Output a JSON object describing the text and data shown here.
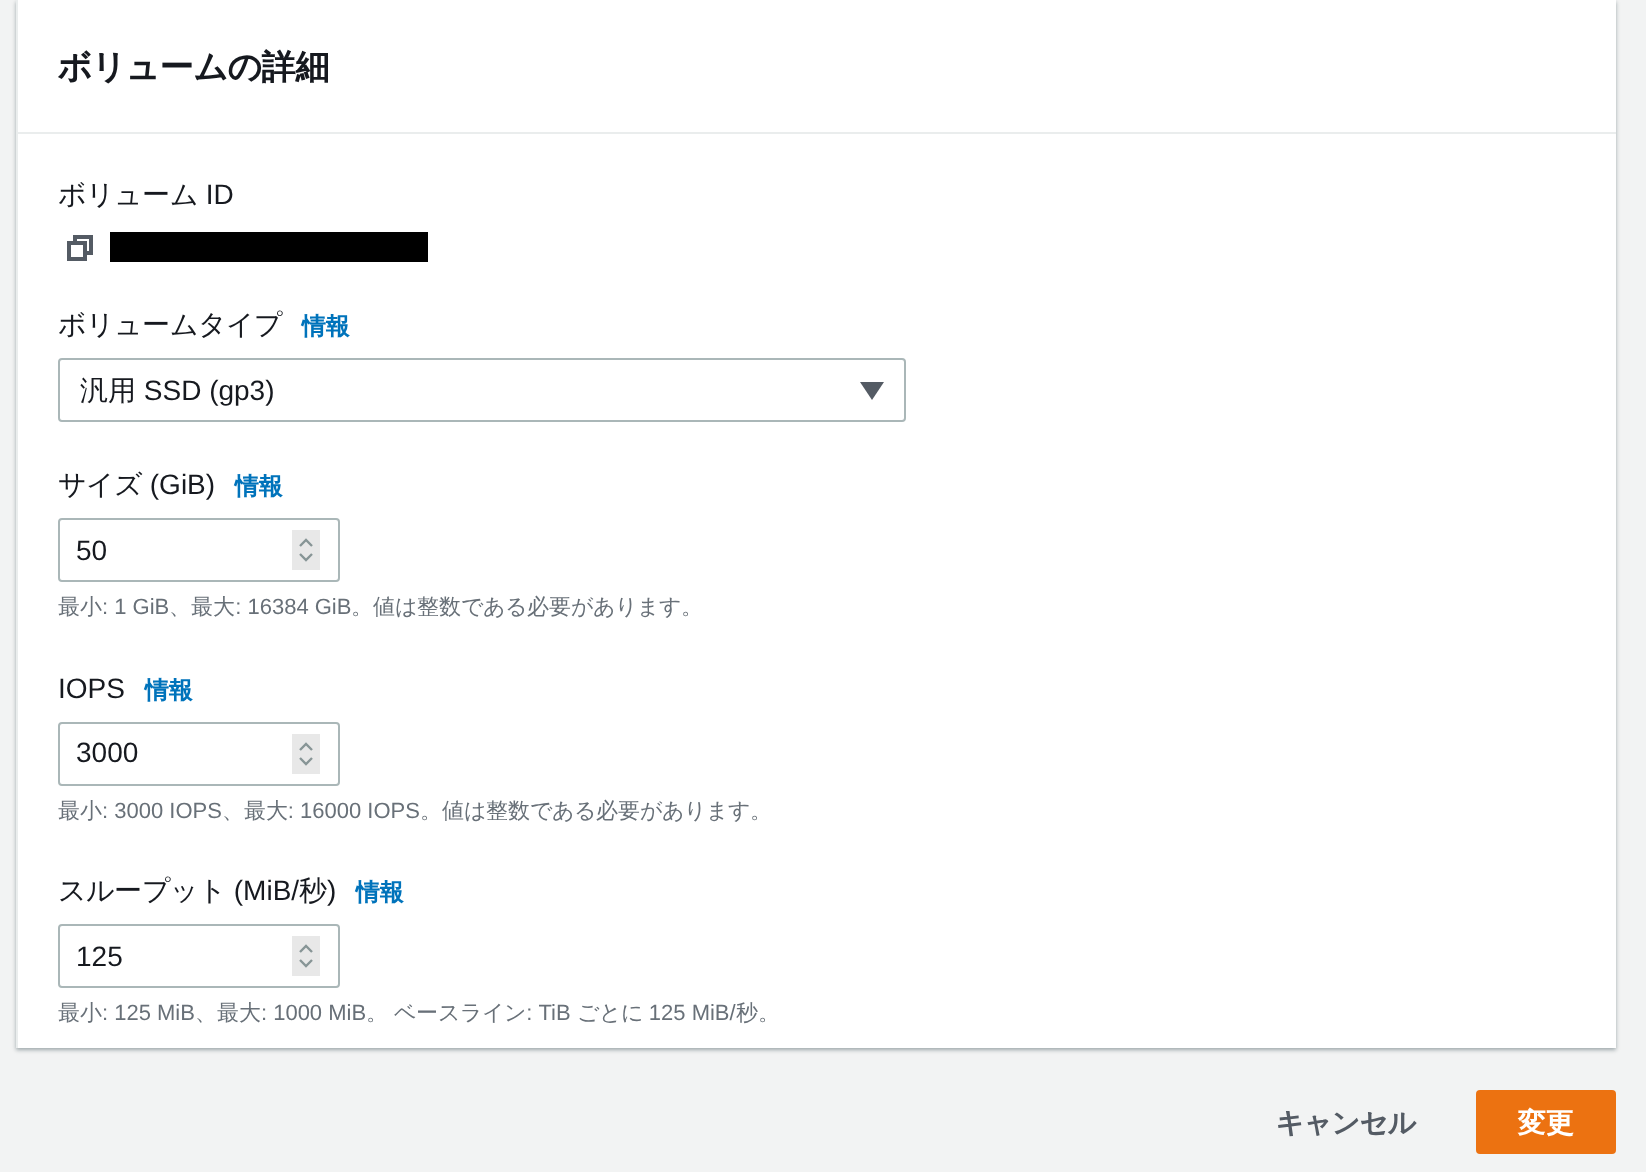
{
  "panel": {
    "title": "ボリュームの詳細"
  },
  "fields": [
    {
      "kind": "id",
      "label": "ボリューム ID"
    },
    {
      "kind": "select",
      "label": "ボリュームタイプ",
      "info": "情報",
      "value": "汎用 SSD (gp3)"
    },
    {
      "kind": "number",
      "label": "サイズ (GiB)",
      "info": "情報",
      "value": "50",
      "hint": "最小: 1 GiB、最大: 16384 GiB。値は整数である必要があります。"
    },
    {
      "kind": "number",
      "label": "IOPS",
      "info": "情報",
      "value": "3000",
      "hint": "最小: 3000 IOPS、最大: 16000 IOPS。値は整数である必要があります。"
    },
    {
      "kind": "number",
      "label": "スループット (MiB/秒)",
      "info": "情報",
      "value": "125",
      "hint": "最小: 125 MiB、最大: 1000 MiB。 ベースライン: TiB ごとに 125 MiB/秒。"
    }
  ],
  "buttons": {
    "cancel": "キャンセル",
    "submit": "変更"
  }
}
